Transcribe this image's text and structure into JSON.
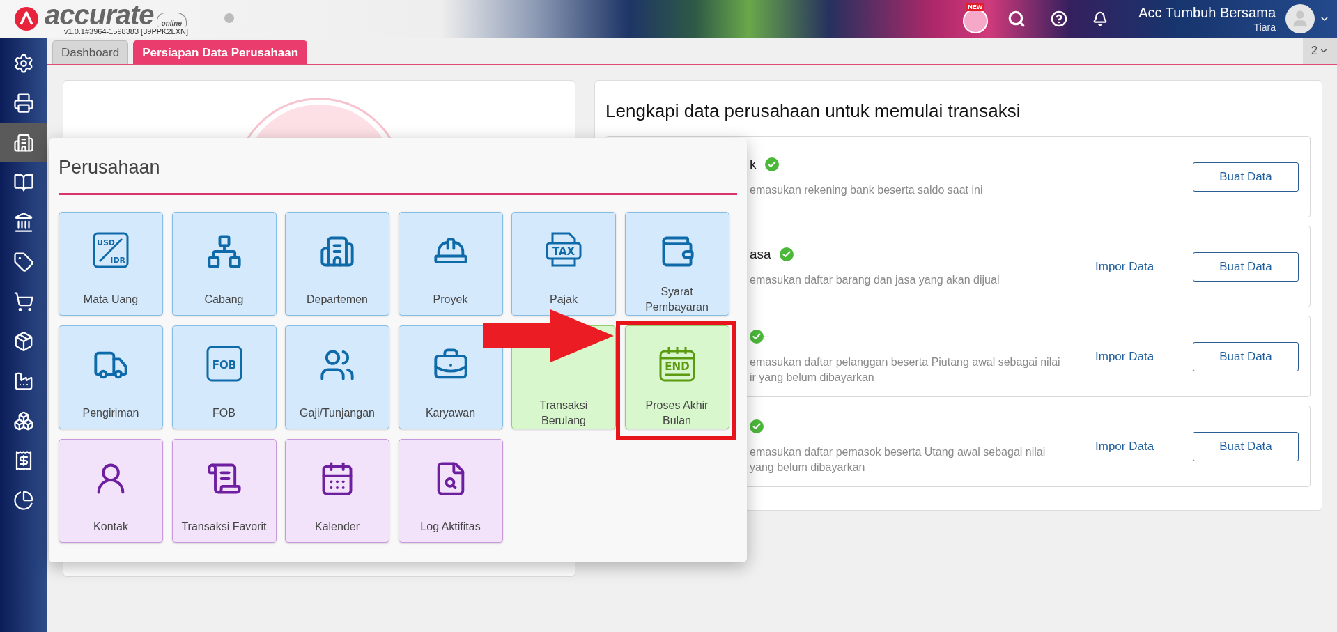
{
  "header": {
    "logo_text": "accurate",
    "logo_badge": "online",
    "version": "v1.0.1#3964-1598383 [39PPK2LXN]",
    "new_badge": "NEW",
    "company": "Acc Tumbuh Bersama",
    "user": "Tiara"
  },
  "sidebar": {
    "items": [
      {
        "selected": false
      },
      {
        "selected": false
      },
      {
        "selected": true
      },
      {
        "selected": false
      },
      {
        "selected": false
      },
      {
        "selected": false
      },
      {
        "selected": false
      },
      {
        "selected": false
      },
      {
        "selected": false
      },
      {
        "selected": false
      },
      {
        "selected": false
      },
      {
        "selected": false
      }
    ]
  },
  "tabs": [
    {
      "label": "Dashboard",
      "selected": false
    },
    {
      "label": "Persiapan Data Perusahaan",
      "selected": true
    }
  ],
  "tab_counter": "2",
  "setup_card": {
    "title": "Lengkapi data perusahaan untuk memulai transaksi",
    "rows": [
      {
        "title": "k",
        "done": true,
        "description": [
          "emasukan rekening bank beserta saldo saat ini"
        ],
        "create_button": "Buat Data"
      },
      {
        "title": "asa",
        "done": true,
        "description": [
          "emasukan daftar barang dan jasa yang akan dijual"
        ],
        "import_link": "Impor Data",
        "create_button": "Buat Data"
      },
      {
        "done": true,
        "description": [
          "emasukan daftar pelanggan beserta Piutang awal sebagai nilai",
          "ir yang belum dibayarkan"
        ],
        "import_link": "Impor Data",
        "create_button": "Buat Data"
      },
      {
        "done": true,
        "description": [
          "emasukan daftar pemasok beserta Utang awal sebagai nilai",
          "yang belum dibayarkan"
        ],
        "import_link": "Impor Data",
        "create_button": "Buat Data"
      }
    ]
  },
  "menu": {
    "title": "Perusahaan",
    "tiles": [
      {
        "label": [
          "Mata Uang"
        ],
        "kind": "master",
        "icon_text": [
          "USD",
          "IDR"
        ]
      },
      {
        "label": [
          "Cabang"
        ],
        "kind": "master"
      },
      {
        "label": [
          "Departemen"
        ],
        "kind": "master"
      },
      {
        "label": [
          "Proyek"
        ],
        "kind": "master"
      },
      {
        "label": [
          "Pajak"
        ],
        "kind": "master",
        "icon_text": [
          "TAX"
        ]
      },
      {
        "label": [
          "Syarat",
          "Pembayaran"
        ],
        "kind": "master"
      },
      {
        "label": [
          "Pengiriman"
        ],
        "kind": "master"
      },
      {
        "label": [
          "FOB"
        ],
        "kind": "master",
        "icon_text": [
          "FOB"
        ]
      },
      {
        "label": [
          "Gaji/Tunjangan"
        ],
        "kind": "master"
      },
      {
        "label": [
          "Karyawan"
        ],
        "kind": "master"
      },
      {
        "label": [
          "Transaksi",
          "Berulang"
        ],
        "kind": "process"
      },
      {
        "label": [
          "Proses Akhir",
          "Bulan"
        ],
        "kind": "process",
        "icon_text": [
          "END"
        ]
      },
      {
        "label": [
          "Kontak"
        ],
        "kind": "other"
      },
      {
        "label": [
          "Transaksi Favorit"
        ],
        "kind": "other"
      },
      {
        "label": [
          "Kalender"
        ],
        "kind": "other"
      },
      {
        "label": [
          "Log Aktifitas"
        ],
        "kind": "other"
      }
    ]
  }
}
